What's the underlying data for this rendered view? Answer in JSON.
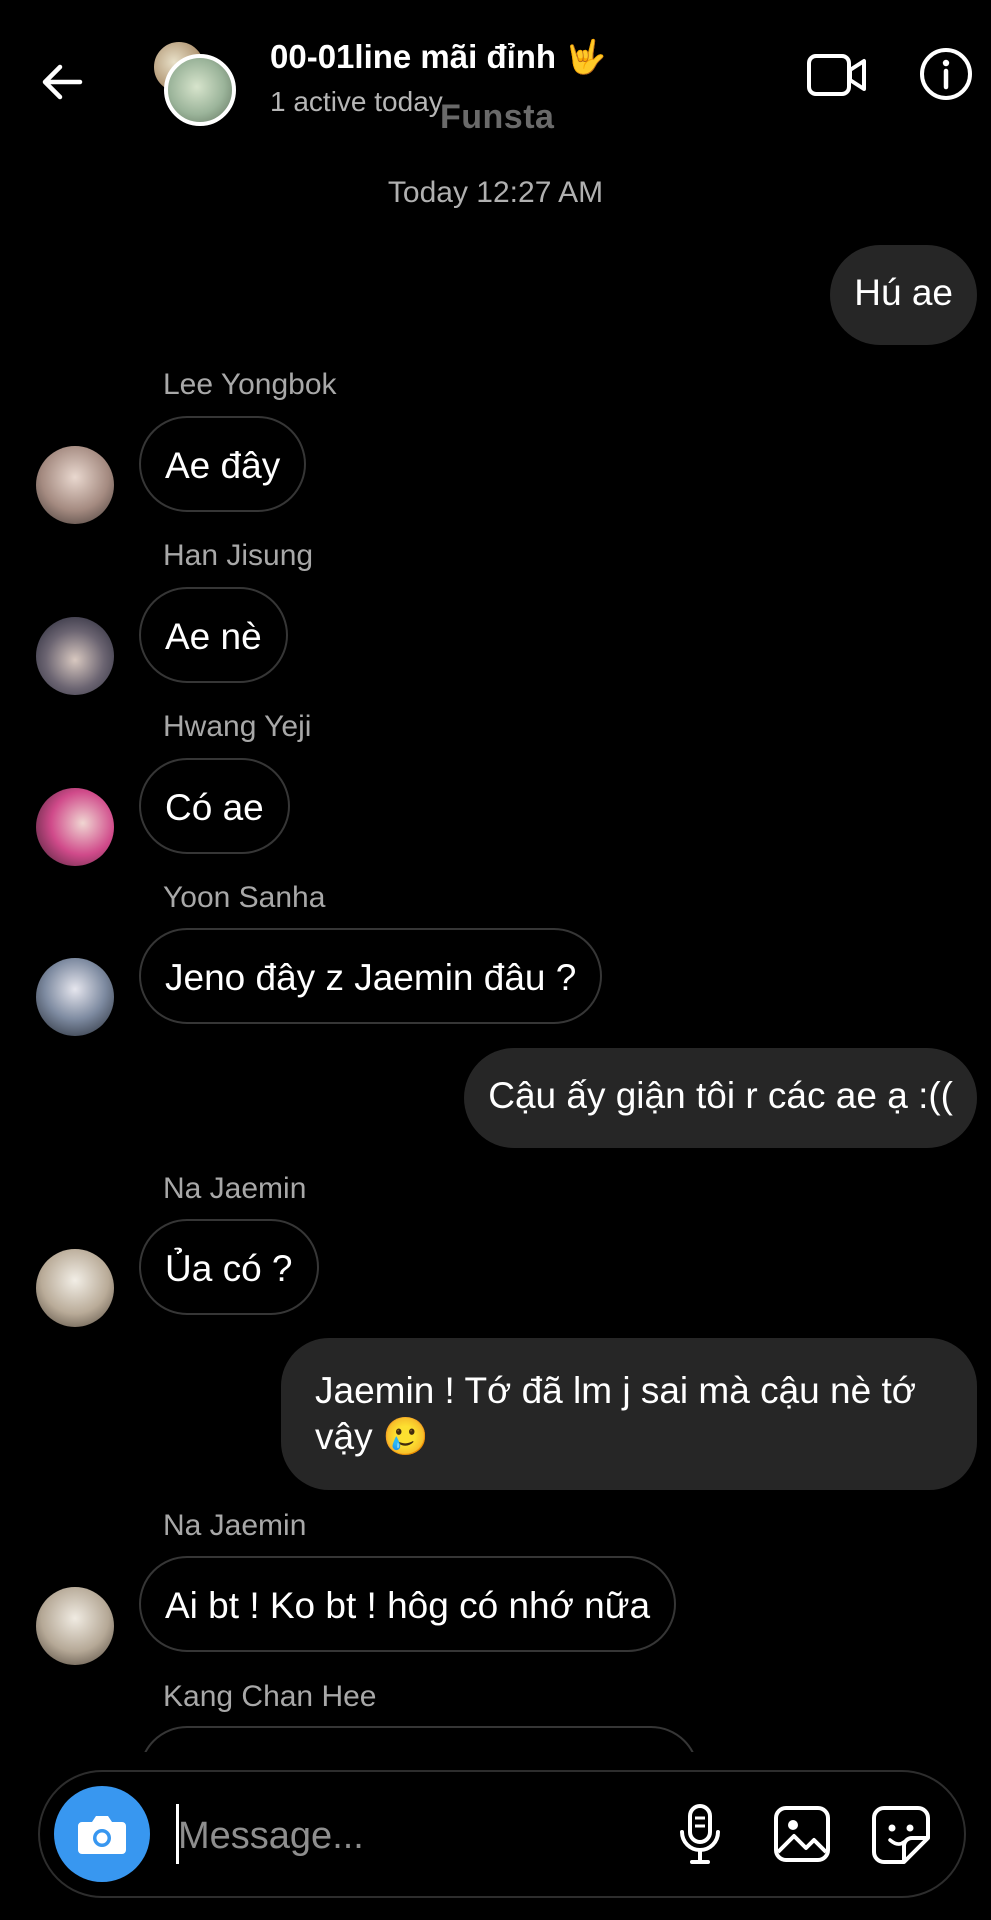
{
  "header": {
    "title": "00-01line mãi đỉnh 🤟",
    "subtitle": "1 active today",
    "watermark": "Funsta"
  },
  "timestamp": "Today 12:27 AM",
  "messages": [
    {
      "direction": "out",
      "text": "Hú ae"
    },
    {
      "direction": "in",
      "sender": "Lee Yongbok",
      "text": "Ae đây"
    },
    {
      "direction": "in",
      "sender": "Han Jisung",
      "text": "Ae nè"
    },
    {
      "direction": "in",
      "sender": "Hwang Yeji",
      "text": "Có ae"
    },
    {
      "direction": "in",
      "sender": "Yoon Sanha",
      "text": "Jeno đây z Jaemin đâu ?"
    },
    {
      "direction": "out",
      "text": "Cậu ấy giận tôi r các ae ạ :(("
    },
    {
      "direction": "in",
      "sender": "Na Jaemin",
      "text": "Ủa có ?"
    },
    {
      "direction": "out",
      "text": "Jaemin ! Tớ đã lm j sai mà cậu nè tớ vậy 🥲"
    },
    {
      "direction": "in",
      "sender": "Na Jaemin",
      "text": "Ai bt ! Ko bt ! hôg có nhớ nữa"
    },
    {
      "direction": "in",
      "sender": "Kang Chan Hee",
      "text": ""
    }
  ],
  "composer": {
    "placeholder": "Message..."
  },
  "colors": {
    "background": "#000000",
    "outgoing_bubble": "#262626",
    "incoming_border": "#363636",
    "camera_button": "#3897f0"
  },
  "icons": [
    "back-arrow-icon",
    "video-call-icon",
    "info-icon",
    "camera-icon",
    "microphone-icon",
    "gallery-icon",
    "sticker-icon"
  ]
}
